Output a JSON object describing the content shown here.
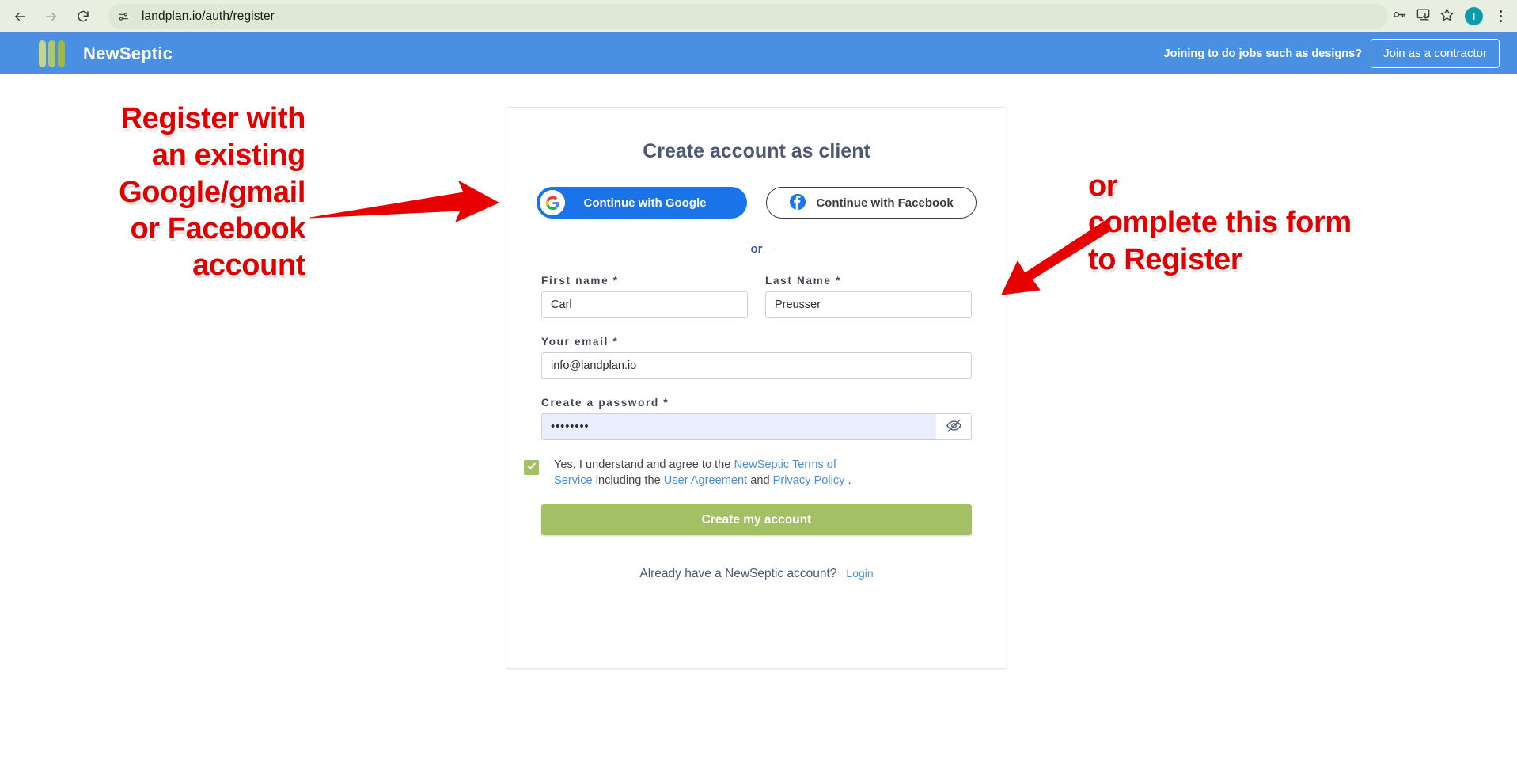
{
  "browser": {
    "url": "landplan.io/auth/register",
    "back_icon": "back-arrow-icon",
    "forward_icon": "forward-arrow-icon",
    "reload_icon": "reload-icon",
    "site_info_icon": "site-settings-icon",
    "password_manager_icon": "key-icon",
    "install_icon": "install-app-icon",
    "bookmark_icon": "star-icon",
    "avatar_initial": "I",
    "menu_icon": "three-dot-menu-icon",
    "toolbar_bg": "#e8efe0",
    "avatar_color": "#0d9aaa"
  },
  "site_header": {
    "brand_name": "NewSeptic",
    "prompt": "Joining to do jobs such as designs?",
    "join_button": "Join as a contractor",
    "bg_color": "#4a90e2",
    "logo_colors": [
      "#c3d490",
      "#afc86d",
      "#9fb83f"
    ]
  },
  "card": {
    "title": "Create account as client",
    "google_button": "Continue with Google",
    "facebook_button": "Continue with Facebook",
    "divider_text": "or",
    "fields": [
      {
        "label": "First name *",
        "value": "Carl",
        "placeholder": "First name",
        "name": "first-name"
      },
      {
        "label": "Last Name *",
        "value": "Preusser",
        "placeholder": "Last Name",
        "name": "last-name"
      },
      {
        "label": "Your email *",
        "value": "info@landplan.io",
        "placeholder": "Your email",
        "name": "email"
      },
      {
        "label": "Create a password *",
        "value": "••••••••",
        "placeholder": "Create a password",
        "name": "password"
      }
    ],
    "terms": {
      "checked": true,
      "lead": "Yes, I understand and agree to the ",
      "link_terms": "NewSeptic Terms of Service",
      "mid": "including the ",
      "link_user_agreement": "User Agreement",
      "and": " and ",
      "link_privacy": "Privacy Policy",
      "trailing": " ."
    },
    "submit_button": "Create my account",
    "login_prompt": "Already have a NewSeptic account?",
    "login_link": "Login",
    "accent_green": "#a4c064",
    "link_blue": "#4a8fd4"
  },
  "annotations": {
    "left_text": "Register with\nan existing\nGoogle/gmail\nor Facebook\naccount",
    "right_text": "or\ncomplete this form\nto Register",
    "color": "#e00000",
    "left_arrow": "red-arrow-pointing-right",
    "right_arrow": "red-arrow-pointing-down-left"
  }
}
